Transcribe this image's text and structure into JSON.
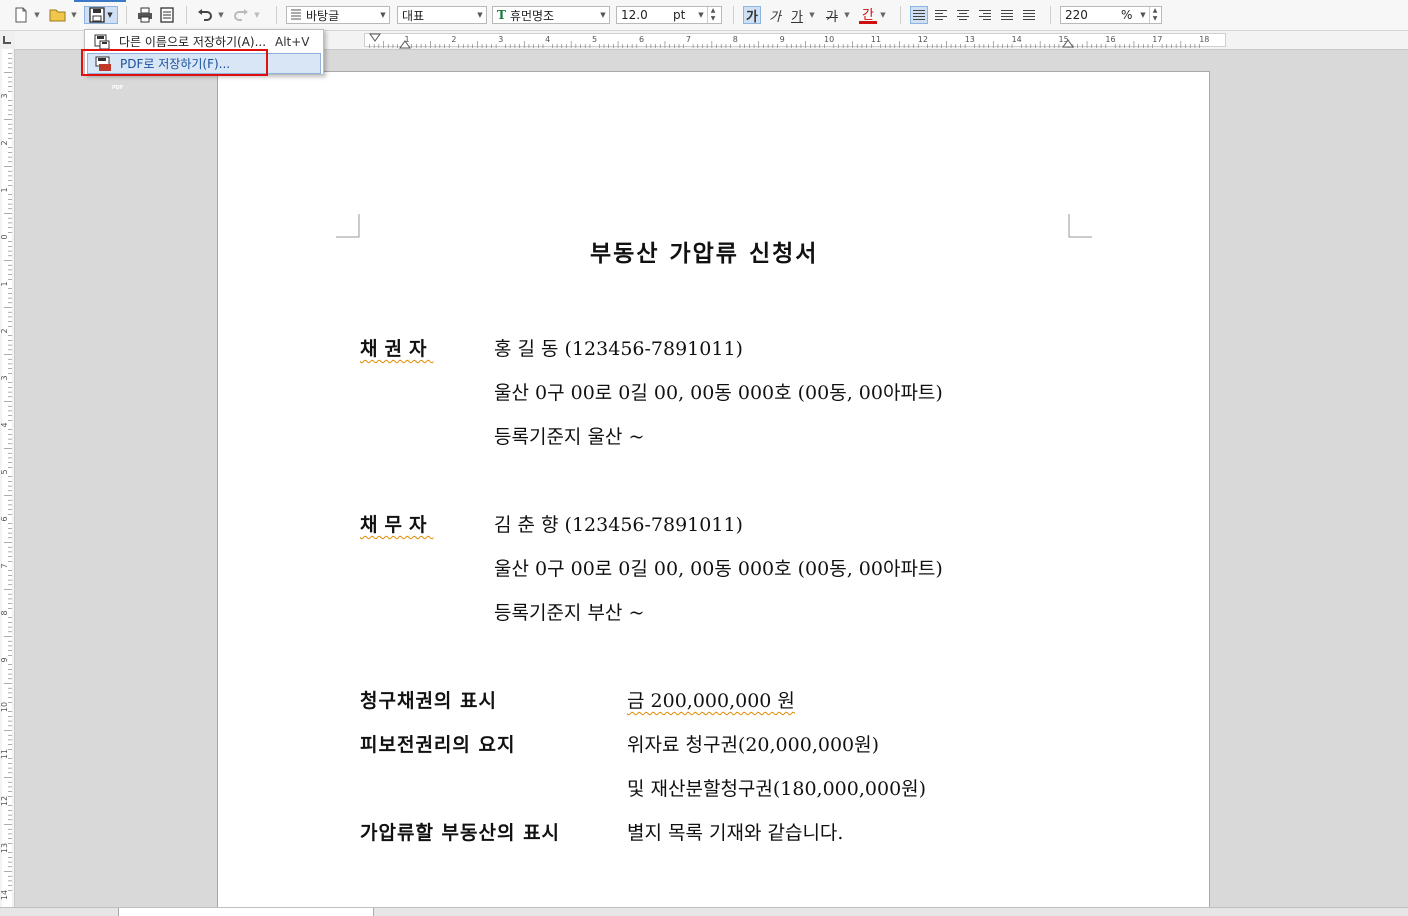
{
  "toolbar": {
    "style_combo": "바탕글",
    "language_combo": "대표",
    "font_combo": "휴먼명조",
    "font_size": "12.0",
    "font_unit": "pt",
    "bold_label": "가",
    "italic_label": "가",
    "underline_label": "가",
    "strike_label": "가",
    "color_label": "간",
    "zoom_value": "220",
    "zoom_unit": "%",
    "font_glyph": "T"
  },
  "save_menu": {
    "items": [
      {
        "label": "다른 이름으로 저장하기(A)...",
        "shortcut": "Alt+V"
      },
      {
        "label": "PDF로 저장하기(F)...",
        "shortcut": ""
      }
    ],
    "pdf_icon_text": "PDF"
  },
  "ruler": {
    "h_ticks": [
      "1",
      "2",
      "3",
      "4",
      "5",
      "6",
      "7",
      "8",
      "9",
      "10",
      "11",
      "12",
      "13",
      "14",
      "15",
      "16",
      "17",
      "18"
    ],
    "v_ticks": [
      "3",
      "2",
      "1",
      "0",
      "1",
      "2",
      "3",
      "4",
      "5",
      "6",
      "7",
      "8",
      "9",
      "10",
      "11",
      "12",
      "13",
      "14"
    ]
  },
  "document": {
    "title": "부동산 가압류 신청서",
    "creditor": {
      "label": "채권자",
      "name_id": "홍 길 동 (123456-7891011)",
      "address": "울산 0구 00로 0길 00, 00동 000호 (00동, 00아파트)",
      "registry": "등록기준지   울산 ~"
    },
    "debtor": {
      "label": "채무자",
      "name_id": "김 춘 향 (123456-7891011)",
      "address": "울산 0구 00로 0길 00, 00동 000호 (00동, 00아파트)",
      "registry": "등록기준지   부산 ~"
    },
    "claim_label": "청구채권의 표시",
    "claim_value": "금  200,000,000 원",
    "right_label": "피보전권리의 요지",
    "right_line1": "위자료 청구권(20,000,000원)",
    "right_line2": "및 재산분할청구권(180,000,000원)",
    "property_label": "가압류할 부동산의 표시",
    "property_value": "별지 목록 기재와 같습니다."
  }
}
